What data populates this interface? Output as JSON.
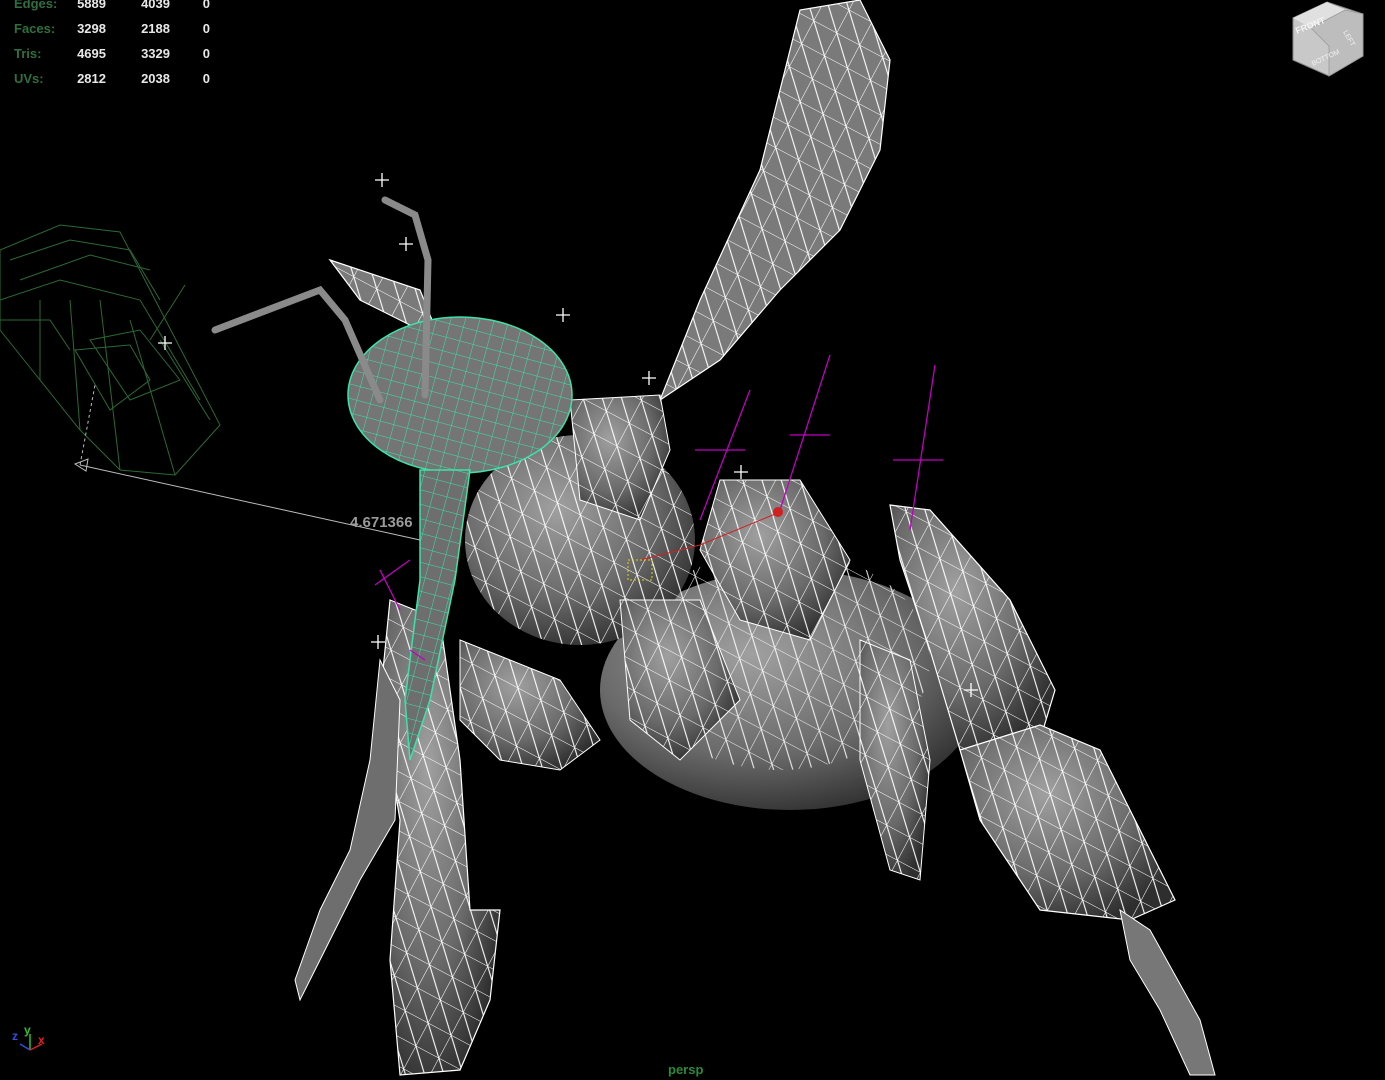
{
  "hud": {
    "rows": [
      {
        "label": "Edges:",
        "col1": "5889",
        "col2": "4039",
        "col3": "0"
      },
      {
        "label": "Faces:",
        "col1": "3298",
        "col2": "2188",
        "col3": "0"
      },
      {
        "label": "Tris:",
        "col1": "4695",
        "col2": "3329",
        "col3": "0"
      },
      {
        "label": "UVs:",
        "col1": "2812",
        "col2": "2038",
        "col3": "0"
      }
    ]
  },
  "measure": {
    "distance_text": "4.671366"
  },
  "camera": {
    "name": "persp"
  },
  "axis_gizmo": {
    "x_label": "x",
    "y_label": "y",
    "z_label": "z"
  },
  "view_cube": {
    "front_label": "FRONT",
    "side_label": "LEFT",
    "bottom_label": "BOTTOM"
  },
  "colors": {
    "background": "#000000",
    "mesh_fill": "#6e6e6e",
    "wire": "#ffffff",
    "selected_wire": "#3ce3a8",
    "joint": "#c000c0",
    "hud_label": "#2f6f3f",
    "locator": "#2a6a34"
  },
  "icons": [
    "view-cube-icon",
    "axis-gizmo-icon",
    "locator-cross-icon"
  ]
}
